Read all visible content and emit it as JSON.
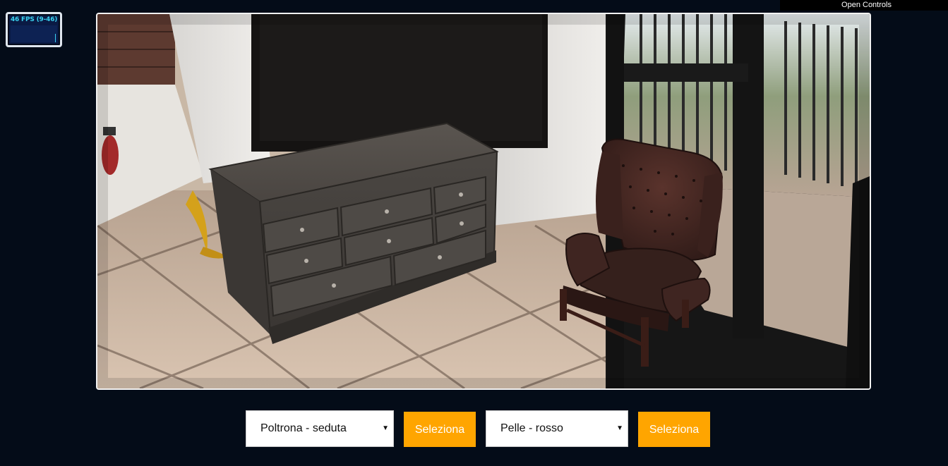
{
  "stats": {
    "fps_label": "46 FPS (9-46)"
  },
  "gui": {
    "toggle_label": "Open Controls"
  },
  "scene": {
    "objects": [
      "chest-of-drawers-icon",
      "armchair-icon"
    ],
    "colors": {
      "dresser": "#4a4642",
      "armchair": "#3e2420",
      "floor": "#c7ad98",
      "wall": "#e9e6e2"
    }
  },
  "controls": {
    "item_select": {
      "value": "Poltrona - seduta"
    },
    "item_button": {
      "label": "Seleziona"
    },
    "material_select": {
      "value": "Pelle - rosso"
    },
    "material_button": {
      "label": "Seleziona"
    },
    "accent_color": "#ffa500"
  }
}
